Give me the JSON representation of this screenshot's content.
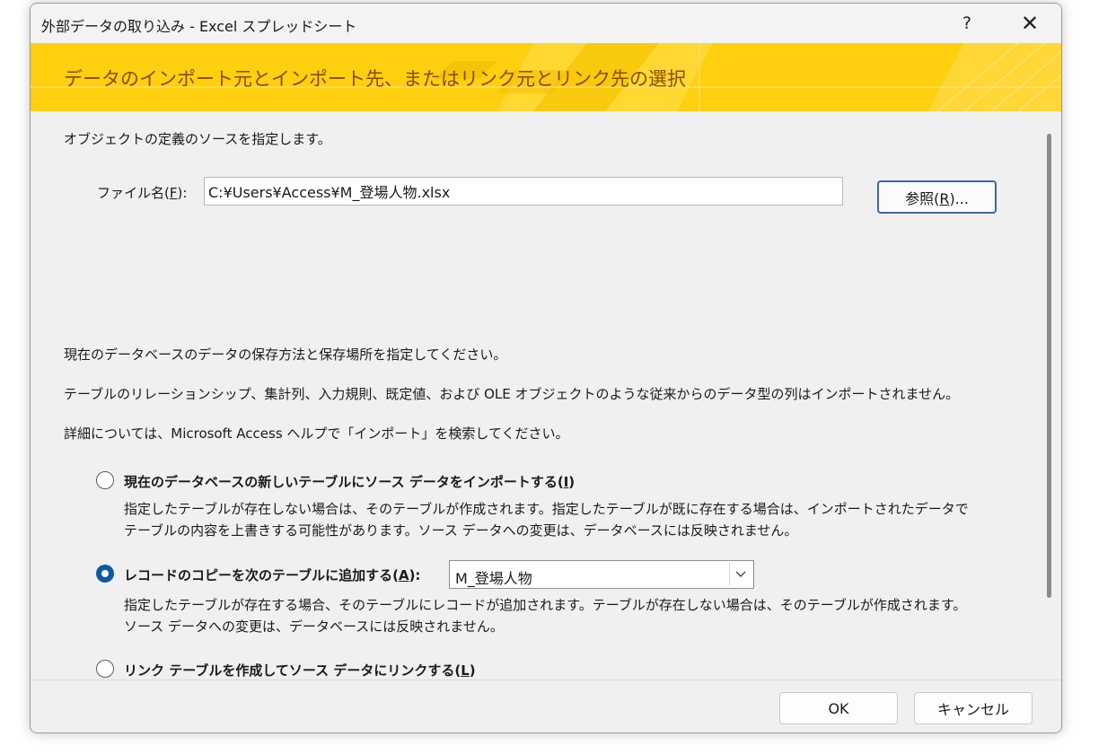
{
  "window": {
    "title": "外部データの取り込み - Excel スプレッドシート",
    "help_label": "?",
    "close_label": "✕"
  },
  "banner": {
    "title": "データのインポート元とインポート先、またはリンク元とリンク先の選択",
    "accent_color": "#ffcf10"
  },
  "source": {
    "instruction": "オブジェクトの定義のソースを指定します。",
    "file_label_prefix": "ファイル名(",
    "file_label_key": "F",
    "file_label_suffix": "):",
    "file_path": "C:¥Users¥Access¥M_登場人物.xlsx",
    "browse_prefix": "参照(",
    "browse_key": "R",
    "browse_suffix": ")..."
  },
  "destination": {
    "instruction": "現在のデータベースのデータの保存方法と保存場所を指定してください。",
    "note": "テーブルのリレーションシップ、集計列、入力規則、既定値、および OLE オブジェクトのような従来からのデータ型の列はインポートされません。",
    "help_text": "詳細については、Microsoft Access ヘルプで「インポート」を検索してください。"
  },
  "options": [
    {
      "label_prefix": "現在のデータベースの新しいテーブルにソース データをインポートする(",
      "key": "I",
      "label_suffix": ")",
      "checked": false,
      "desc_line1": "指定したテーブルが存在しない場合は、そのテーブルが作成されます。指定したテーブルが既に存在する場合は、インポートされたデータで",
      "desc_line2": "テーブルの内容を上書きする可能性があります。ソース データへの変更は、データベースには反映されません。"
    },
    {
      "label_prefix": "レコードのコピーを次のテーブルに追加する(",
      "key": "A",
      "label_suffix": "):",
      "checked": true,
      "table_value": "M_登場人物",
      "desc_line1": "指定したテーブルが存在する場合、そのテーブルにレコードが追加されます。テーブルが存在しない場合は、そのテーブルが作成されます。",
      "desc_line2": "ソース データへの変更は、データベースには反映されません。"
    },
    {
      "label_prefix": "リンク テーブルを作成してソース データにリンクする(",
      "key": "L",
      "label_suffix": ")",
      "checked": false
    }
  ],
  "footer": {
    "ok_label": "OK",
    "cancel_label": "キャンセル"
  },
  "colors": {
    "radio_checked": "#0c59a8",
    "banner_text": "#8a4b00",
    "focus_border": "#3b67a8"
  }
}
